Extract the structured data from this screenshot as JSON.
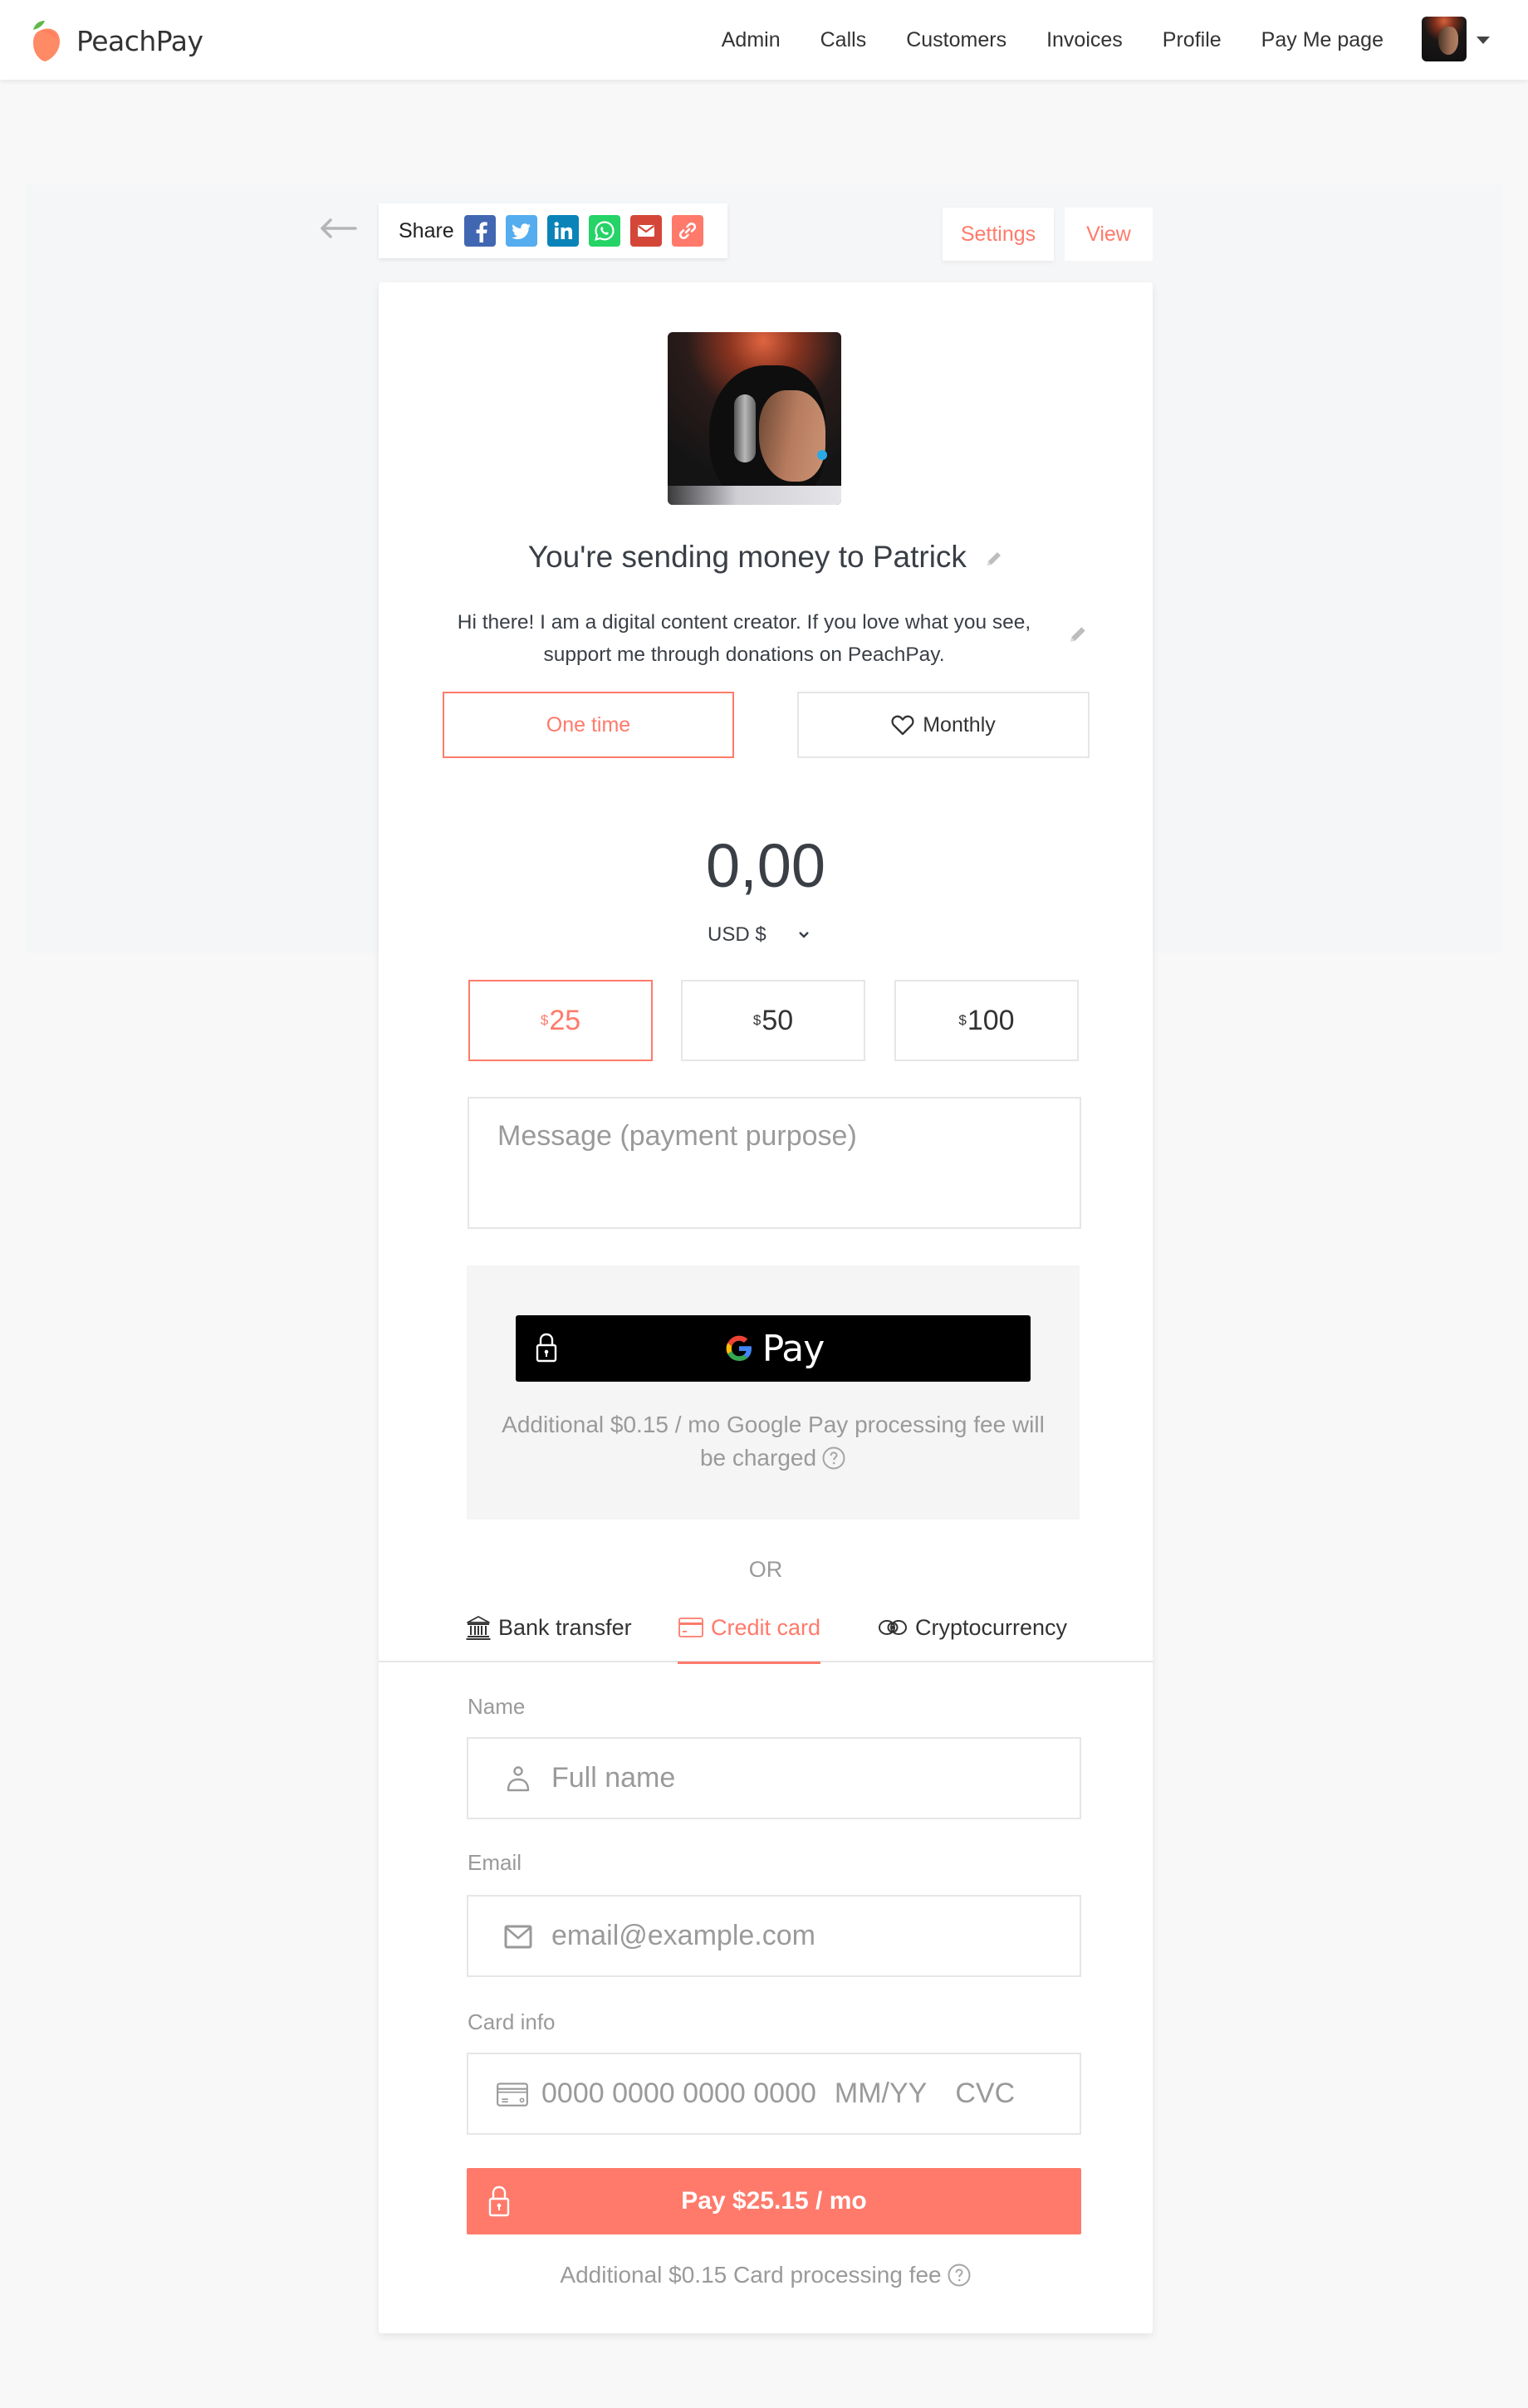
{
  "app": {
    "brand": "PeachPay",
    "accent_color": "#ff7a6b"
  },
  "nav": {
    "items": [
      {
        "label": "Admin"
      },
      {
        "label": "Calls"
      },
      {
        "label": "Customers"
      },
      {
        "label": "Invoices"
      },
      {
        "label": "Profile"
      },
      {
        "label": "Pay Me page"
      }
    ],
    "avatar_icon": "user-avatar",
    "menu_icon": "caret-down-icon"
  },
  "toolbar": {
    "back_icon": "arrow-left-icon",
    "share_label": "Share",
    "share_icons": [
      {
        "name": "facebook-icon",
        "color": "#4267b2"
      },
      {
        "name": "twitter-icon",
        "color": "#55acee"
      },
      {
        "name": "linkedin-icon",
        "color": "#0a84b8"
      },
      {
        "name": "whatsapp-icon",
        "color": "#25d366"
      },
      {
        "name": "email-icon",
        "color": "#d44638"
      },
      {
        "name": "link-icon",
        "color": "#ff7a6b"
      }
    ],
    "settings_label": "Settings",
    "view_label": "View"
  },
  "profile": {
    "headline": "You're sending money to Patrick",
    "description": "Hi there! I am a digital content creator. If you love what you see, support me through donations on PeachPay."
  },
  "frequency": {
    "options": [
      {
        "label": "One time",
        "selected": true
      },
      {
        "label": "Monthly",
        "icon": "heart-icon",
        "selected": false
      }
    ]
  },
  "amount": {
    "value": "0,00",
    "currency": "USD $",
    "presets": [
      {
        "symbol": "$",
        "value": "25",
        "selected": true
      },
      {
        "symbol": "$",
        "value": "50",
        "selected": false
      },
      {
        "symbol": "$",
        "value": "100",
        "selected": false
      }
    ]
  },
  "message": {
    "placeholder": "Message (payment purpose)"
  },
  "gpay": {
    "button_label": "Pay",
    "note": "Additional $0.15 / mo Google Pay processing fee will be charged"
  },
  "methods": {
    "or_label": "OR",
    "tabs": [
      {
        "label": "Bank transfer",
        "icon": "bank-icon",
        "active": false
      },
      {
        "label": "Credit card",
        "icon": "credit-card-icon",
        "active": true
      },
      {
        "label": "Cryptocurrency",
        "icon": "crypto-icon",
        "active": false
      }
    ]
  },
  "form": {
    "name_label": "Name",
    "name_placeholder": "Full name",
    "email_label": "Email",
    "email_placeholder": "email@example.com",
    "card_label": "Card info",
    "card_number_placeholder": "0000 0000 0000 0000",
    "card_expiry_placeholder": "MM/YY",
    "card_cvc_placeholder": "CVC",
    "pay_button": "Pay $25.15 / mo",
    "card_note": "Additional $0.15 Card processing fee"
  }
}
